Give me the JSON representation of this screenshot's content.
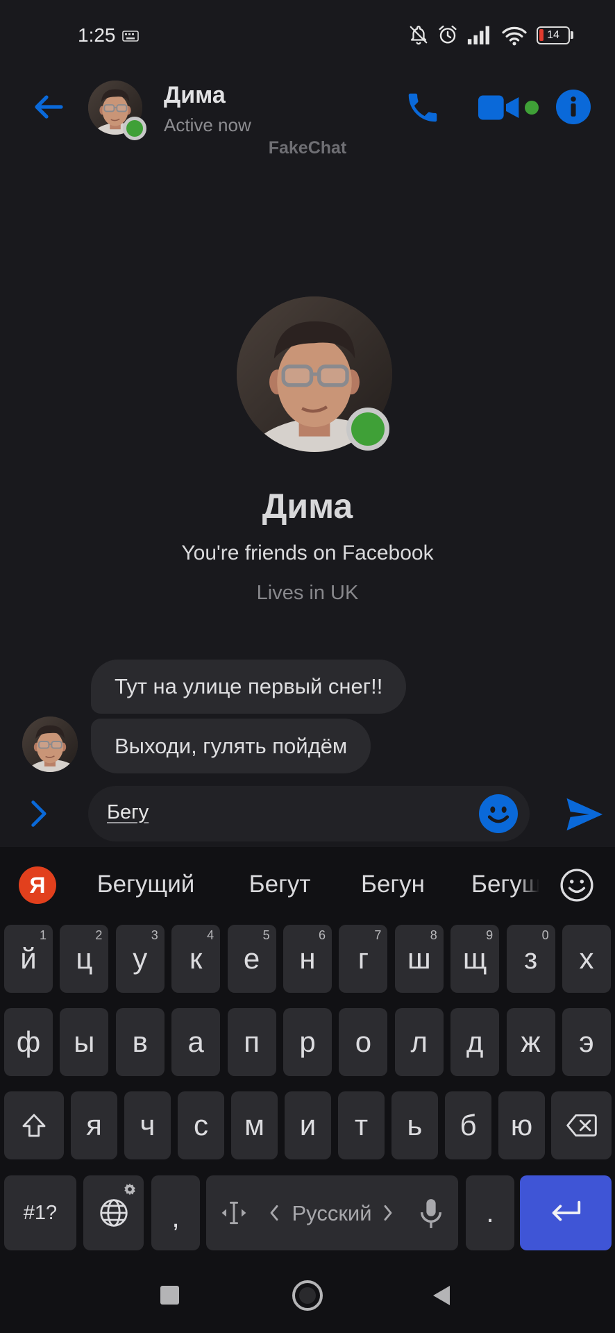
{
  "status_bar": {
    "time": "1:25",
    "battery": "14",
    "icons": [
      "keyboard-icon",
      "bell-off-icon",
      "alarm-icon",
      "signal-icon",
      "wifi-icon",
      "battery-icon"
    ]
  },
  "header": {
    "name": "Дима",
    "status": "Active now",
    "watermark": "FakeChat",
    "icons": {
      "back": "arrow-left-icon",
      "call": "phone-icon",
      "video": "video-camera-icon",
      "info": "info-icon"
    }
  },
  "profile": {
    "name": "Дима",
    "friends": "You're friends on Facebook",
    "location": "Lives in UK"
  },
  "messages": [
    {
      "text": "Тут на улице первый снег!!"
    },
    {
      "text": "Выходи, гулять пойдём"
    }
  ],
  "composer": {
    "value": "Бегу",
    "icons": {
      "expand": "chevron-right-icon",
      "emoji": "emoji-icon",
      "send": "send-icon"
    }
  },
  "keyboard": {
    "logo": "Я",
    "suggestions": [
      "Бегущий",
      "Бегут",
      "Бегун",
      "Бегущ"
    ],
    "rows": [
      {
        "keys": [
          "й",
          "ц",
          "у",
          "к",
          "е",
          "н",
          "г",
          "ш",
          "щ",
          "з",
          "х"
        ],
        "hints": [
          "1",
          "2",
          "3",
          "4",
          "5",
          "6",
          "7",
          "8",
          "9",
          "0",
          ""
        ]
      },
      {
        "keys": [
          "ф",
          "ы",
          "в",
          "а",
          "п",
          "р",
          "о",
          "л",
          "д",
          "ж",
          "э"
        ]
      },
      {
        "keys": [
          "я",
          "ч",
          "с",
          "м",
          "и",
          "т",
          "ь",
          "б",
          "ю"
        ]
      }
    ],
    "bottom": {
      "symbols": "#1?",
      "comma": ",",
      "language": "Русский",
      "period": "."
    },
    "icons": [
      "shift-icon",
      "backspace-icon",
      "globe-icon",
      "settings-gear-icon",
      "cursor-icon",
      "microphone-icon",
      "enter-icon",
      "emoji-outline-icon"
    ]
  },
  "nav_bar": {
    "icons": [
      "recents-square-icon",
      "home-circle-icon",
      "back-triangle-icon"
    ]
  },
  "colors": {
    "accent": "#0a69d9",
    "presence": "#3fa037",
    "enter_key": "#3f55d6",
    "yandex": "#e2401d",
    "background": "#19191d"
  }
}
